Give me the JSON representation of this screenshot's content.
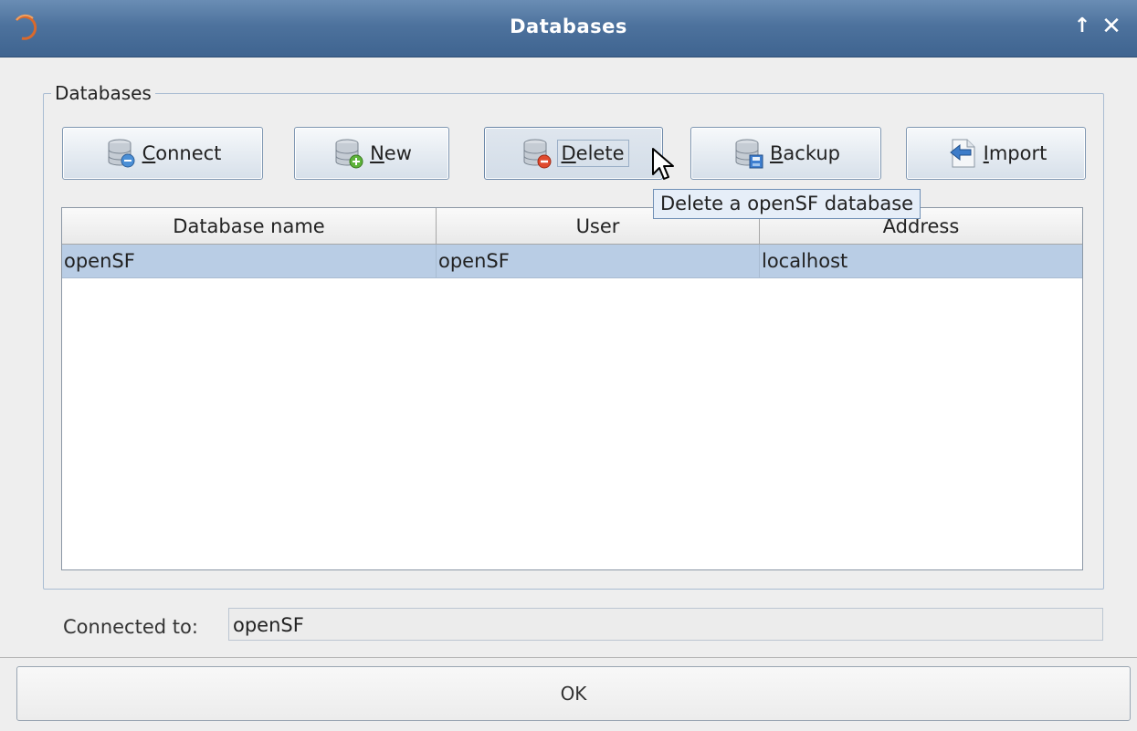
{
  "window": {
    "title": "Databases",
    "controls": {
      "restore_icon": "up-arrow-icon",
      "close_icon": "close-icon"
    }
  },
  "group": {
    "title": "Databases"
  },
  "toolbar": {
    "connect": {
      "mnemonic": "C",
      "rest": "onnect",
      "icon": "database-connect-icon"
    },
    "new": {
      "mnemonic": "N",
      "rest": "ew",
      "icon": "database-add-icon"
    },
    "delete": {
      "mnemonic": "D",
      "rest": "elete",
      "icon": "database-delete-icon"
    },
    "backup": {
      "mnemonic": "B",
      "rest": "ackup",
      "icon": "database-backup-icon"
    },
    "import": {
      "mnemonic": "I",
      "rest": "mport",
      "icon": "import-icon"
    }
  },
  "tooltip": {
    "text": "Delete a openSF database"
  },
  "table": {
    "columns": [
      "Database name",
      "User",
      "Address"
    ],
    "rows": [
      {
        "database_name": "openSF",
        "user": "openSF",
        "address": "localhost",
        "selected": true
      }
    ]
  },
  "status": {
    "label": "Connected to:",
    "value": "openSF"
  },
  "footer": {
    "ok_label": "OK"
  },
  "colors": {
    "titlebar": "#4d729d",
    "selection": "#b9cde5",
    "tooltip_bg": "#e6eef8"
  }
}
